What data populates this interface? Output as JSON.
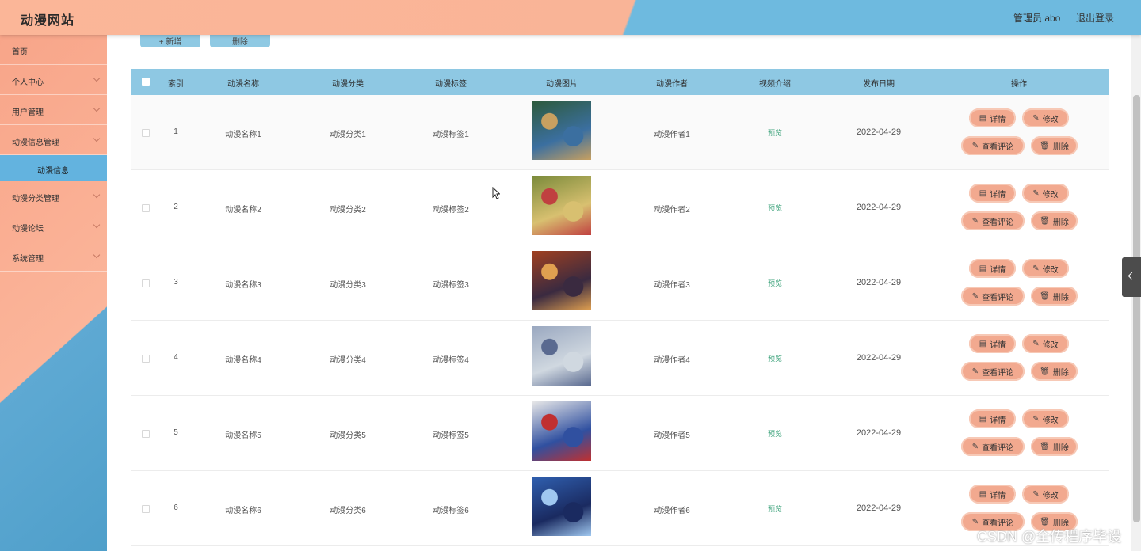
{
  "header": {
    "brand": "动漫网站",
    "admin": "管理员 abo",
    "logout": "退出登录"
  },
  "sidebar": {
    "items": [
      {
        "label": "首页",
        "chevron": false
      },
      {
        "label": "个人中心",
        "chevron": true
      },
      {
        "label": "用户管理",
        "chevron": true
      },
      {
        "label": "动漫信息管理",
        "chevron": true
      },
      {
        "label": "动漫分类管理",
        "chevron": true
      },
      {
        "label": "动漫论坛",
        "chevron": true
      },
      {
        "label": "系统管理",
        "chevron": true
      }
    ],
    "sub_active": "动漫信息"
  },
  "toolbar": {
    "add_label": "+ 新增",
    "delete_label": "删除"
  },
  "table": {
    "headers": [
      "索引",
      "动漫名称",
      "动漫分类",
      "动漫标签",
      "动漫图片",
      "动漫作者",
      "视频介绍",
      "发布日期",
      "操作"
    ],
    "rows": [
      {
        "index": "1",
        "name": "动漫名称1",
        "category": "动漫分类1",
        "tag": "动漫标签1",
        "author": "动漫作者1",
        "video": "预览",
        "date": "2022-04-29"
      },
      {
        "index": "2",
        "name": "动漫名称2",
        "category": "动漫分类2",
        "tag": "动漫标签2",
        "author": "动漫作者2",
        "video": "预览",
        "date": "2022-04-29"
      },
      {
        "index": "3",
        "name": "动漫名称3",
        "category": "动漫分类3",
        "tag": "动漫标签3",
        "author": "动漫作者3",
        "video": "预览",
        "date": "2022-04-29"
      },
      {
        "index": "4",
        "name": "动漫名称4",
        "category": "动漫分类4",
        "tag": "动漫标签4",
        "author": "动漫作者4",
        "video": "预览",
        "date": "2022-04-29"
      },
      {
        "index": "5",
        "name": "动漫名称5",
        "category": "动漫分类5",
        "tag": "动漫标签5",
        "author": "动漫作者5",
        "video": "预览",
        "date": "2022-04-29"
      },
      {
        "index": "6",
        "name": "动漫名称6",
        "category": "动漫分类6",
        "tag": "动漫标签6",
        "author": "动漫作者6",
        "video": "预览",
        "date": "2022-04-29"
      }
    ],
    "actions": {
      "detail": "详情",
      "edit": "修改",
      "comments": "查看评论",
      "delete": "删除"
    }
  },
  "thumbnails": [
    {
      "colors": [
        "#2d5a3a",
        "#c8a060",
        "#3b6fa0"
      ]
    },
    {
      "colors": [
        "#7a8a3a",
        "#c04040",
        "#d8c070"
      ]
    },
    {
      "colors": [
        "#a04020",
        "#e0a050",
        "#3a2a40"
      ]
    },
    {
      "colors": [
        "#9aa8c0",
        "#5a6a90",
        "#d0d8e0"
      ]
    },
    {
      "colors": [
        "#e8e8e8",
        "#c03030",
        "#3050a0"
      ]
    },
    {
      "colors": [
        "#3060b0",
        "#a0c8f0",
        "#1a2a60"
      ]
    }
  ],
  "watermark": "CSDN @全传程序毕设"
}
